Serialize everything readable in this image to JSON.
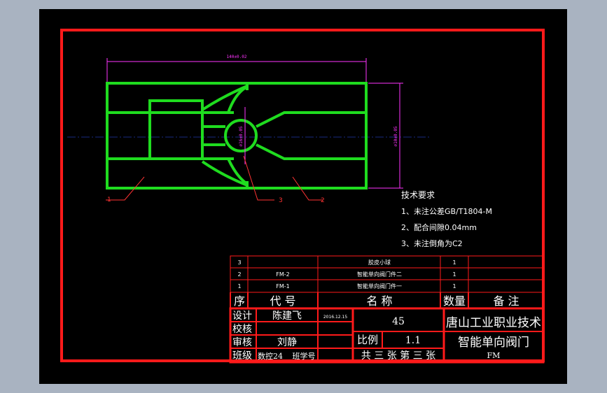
{
  "drawing": {
    "dimension_width": "140±0.02",
    "dimension_height": "∅10±0.05",
    "dimension_inner": "∅16±0.05",
    "part_labels": [
      "1",
      "3",
      "2"
    ]
  },
  "tech_requirements": {
    "title": "技术要求",
    "items": [
      "1、未注公差GB/T1804-M",
      "2、配合间隙0.04mm",
      "3、未注倒角为C2"
    ]
  },
  "bom": {
    "rows": [
      {
        "no": "3",
        "code": "",
        "name": "胶皮小球",
        "qty": "1",
        "note": ""
      },
      {
        "no": "2",
        "code": "FM-2",
        "name": "智能单向阀门件二",
        "qty": "1",
        "note": ""
      },
      {
        "no": "1",
        "code": "FM-1",
        "name": "智能单向阀门件一",
        "qty": "1",
        "note": ""
      }
    ],
    "header": {
      "no": "序",
      "code": "代 号",
      "name": "名 称",
      "qty": "数量",
      "note": "备 注"
    }
  },
  "title_block": {
    "design_label": "设计",
    "designer": "陈建飞",
    "date": "2016.12.15",
    "check_label": "校核",
    "review_label": "审核",
    "reviewer": "刘静",
    "class_label": "班级",
    "class_value": "数控24",
    "student_no_label": "班学号",
    "number": "45",
    "school": "唐山工业职业技术",
    "scale_label": "比例",
    "scale_value": "1.1",
    "part_name": "智能单向阀门",
    "sheet_info": "共 三 张 第 三 张",
    "drawing_code": "FM"
  }
}
